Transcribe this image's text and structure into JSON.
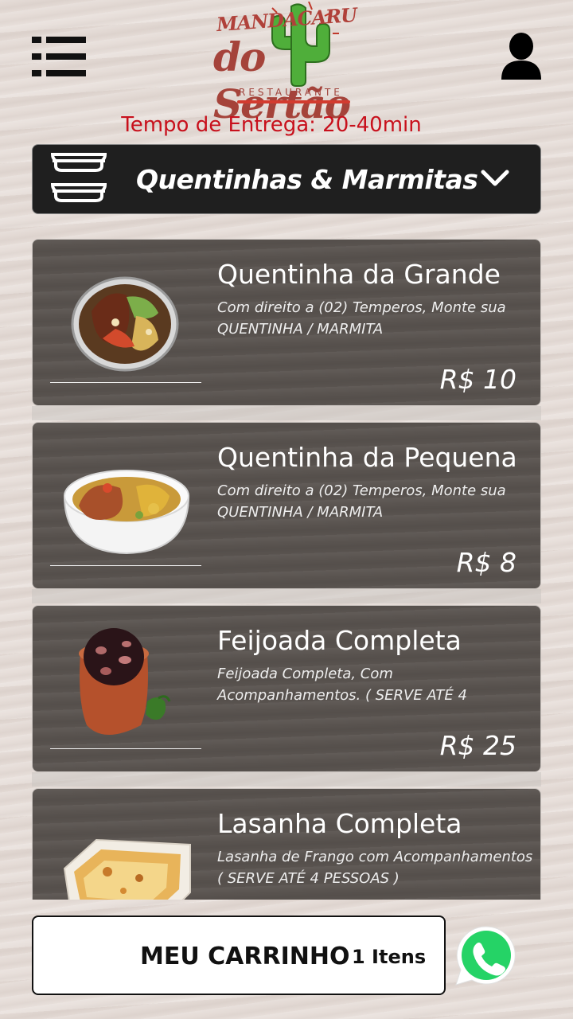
{
  "header": {
    "logo_text_top": "MANDACARU",
    "logo_text_main": "do Sertão",
    "logo_text_sub": "RESTAURANTE",
    "delivery_text": "Tempo de Entrega: 20-40min"
  },
  "category": {
    "label": "Quentinhas & Marmitas",
    "icon": "bowl-stack-icon"
  },
  "items": [
    {
      "title": "Quentinha da Grande",
      "description": "Com direito a (02) Temperos, Monte sua QUENTINHA / MARMITA",
      "price": "R$ 10",
      "image": "marmita-aluminum-photo"
    },
    {
      "title": "Quentinha da Pequena",
      "description": "Com direito a (02) Temperos, Monte sua QUENTINHA / MARMITA",
      "price": "R$ 8",
      "image": "marmita-white-bowl-photo"
    },
    {
      "title": "Feijoada Completa",
      "description": "Feijoada Completa, Com Acompanhamentos. ( SERVE ATÉ 4",
      "price": "R$ 25",
      "image": "feijoada-clay-pot-photo"
    },
    {
      "title": "Lasanha Completa",
      "description": "Lasanha de Frango com Acompanhamentos ( SERVE ATÉ 4 PESSOAS )",
      "price": "",
      "image": "lasanha-dish-photo"
    }
  ],
  "cart": {
    "label": "MEU CARRINHO",
    "count": "1 Itens"
  },
  "colors": {
    "delivery_text": "#c8101c",
    "category_bg": "#1f1f1f",
    "item_card_bg": "#59534f",
    "whatsapp": "#25d366"
  }
}
